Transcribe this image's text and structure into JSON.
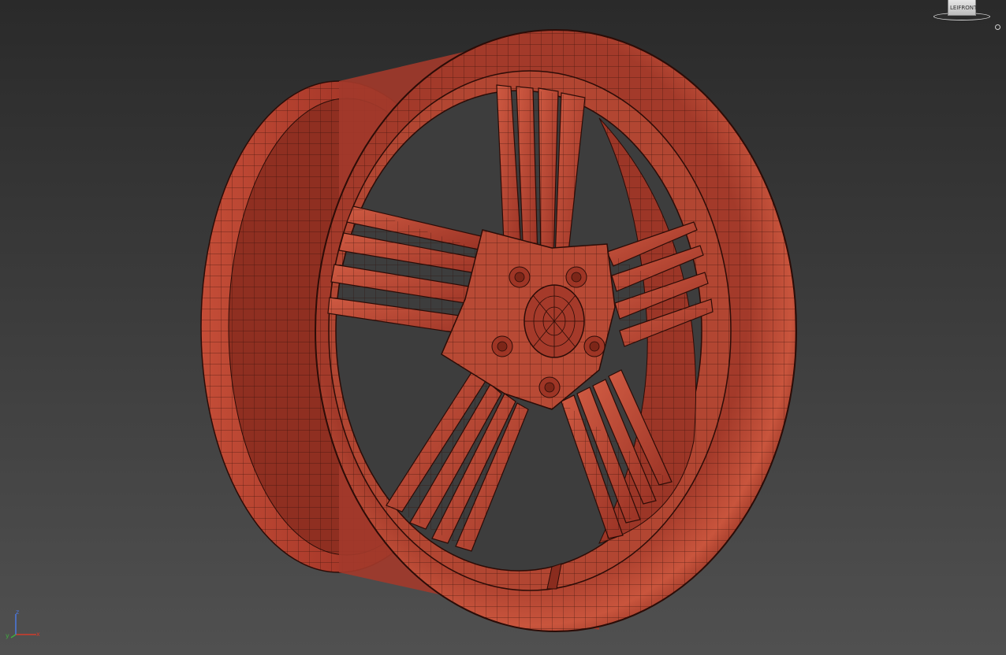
{
  "viewcube": {
    "left_face_label": "LEI",
    "front_face_label": "FRONT"
  },
  "axis_tripod": {
    "x_label": "x",
    "y_label": "y",
    "z_label": "z"
  },
  "colors": {
    "viewport_top": "#2a2a2a",
    "viewport_bottom": "#505050",
    "model_red": "#b8432f",
    "model_wire": "#2b0c07",
    "axis_x": "#d23b2b",
    "axis_y": "#3fae3f",
    "axis_z": "#4a78e0"
  },
  "icons": {
    "viewcube": "viewcube-icon",
    "home": "home-icon",
    "axis": "axis-tripod-icon"
  }
}
